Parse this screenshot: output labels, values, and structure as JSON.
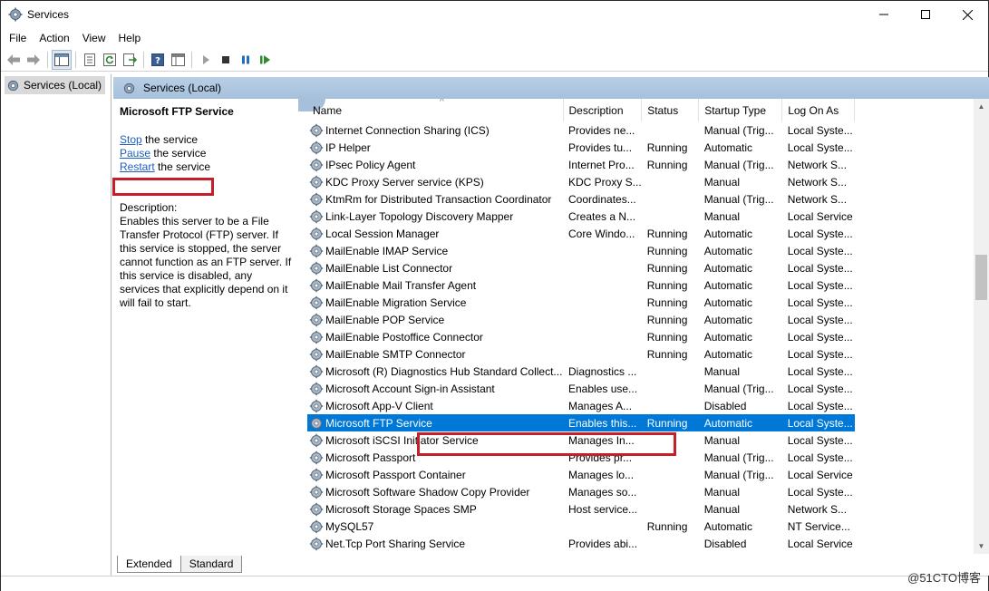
{
  "window": {
    "title": "Services"
  },
  "menu": [
    "File",
    "Action",
    "View",
    "Help"
  ],
  "tree": {
    "item": "Services (Local)"
  },
  "content_header": "Services (Local)",
  "detail": {
    "title": "Microsoft FTP Service",
    "actions": [
      {
        "link": "Stop",
        "rest": " the service"
      },
      {
        "link": "Pause",
        "rest": " the service"
      },
      {
        "link": "Restart",
        "rest": " the service"
      }
    ],
    "desc_label": "Description:",
    "desc_text": "Enables this server to be a File Transfer Protocol (FTP) server. If this service is stopped, the server cannot function as an FTP server. If this service is disabled, any services that explicitly depend on it will fail to start."
  },
  "columns": [
    "Name",
    "Description",
    "Status",
    "Startup Type",
    "Log On As"
  ],
  "rows": [
    [
      "Internet Connection Sharing (ICS)",
      "Provides ne...",
      "",
      "Manual (Trig...",
      "Local Syste..."
    ],
    [
      "IP Helper",
      "Provides tu...",
      "Running",
      "Automatic",
      "Local Syste..."
    ],
    [
      "IPsec Policy Agent",
      "Internet Pro...",
      "Running",
      "Manual (Trig...",
      "Network S..."
    ],
    [
      "KDC Proxy Server service (KPS)",
      "KDC Proxy S...",
      "",
      "Manual",
      "Network S..."
    ],
    [
      "KtmRm for Distributed Transaction Coordinator",
      "Coordinates...",
      "",
      "Manual (Trig...",
      "Network S..."
    ],
    [
      "Link-Layer Topology Discovery Mapper",
      "Creates a N...",
      "",
      "Manual",
      "Local Service"
    ],
    [
      "Local Session Manager",
      "Core Windo...",
      "Running",
      "Automatic",
      "Local Syste..."
    ],
    [
      "MailEnable IMAP Service",
      "",
      "Running",
      "Automatic",
      "Local Syste..."
    ],
    [
      "MailEnable List Connector",
      "",
      "Running",
      "Automatic",
      "Local Syste..."
    ],
    [
      "MailEnable Mail Transfer Agent",
      "",
      "Running",
      "Automatic",
      "Local Syste..."
    ],
    [
      "MailEnable Migration Service",
      "",
      "Running",
      "Automatic",
      "Local Syste..."
    ],
    [
      "MailEnable POP Service",
      "",
      "Running",
      "Automatic",
      "Local Syste..."
    ],
    [
      "MailEnable Postoffice Connector",
      "",
      "Running",
      "Automatic",
      "Local Syste..."
    ],
    [
      "MailEnable SMTP Connector",
      "",
      "Running",
      "Automatic",
      "Local Syste..."
    ],
    [
      "Microsoft (R) Diagnostics Hub Standard Collect...",
      "Diagnostics ...",
      "",
      "Manual",
      "Local Syste..."
    ],
    [
      "Microsoft Account Sign-in Assistant",
      "Enables use...",
      "",
      "Manual (Trig...",
      "Local Syste..."
    ],
    [
      "Microsoft App-V Client",
      "Manages A...",
      "",
      "Disabled",
      "Local Syste..."
    ],
    [
      "Microsoft FTP Service",
      "Enables this...",
      "Running",
      "Automatic",
      "Local Syste..."
    ],
    [
      "Microsoft iSCSI Initiator Service",
      "Manages In...",
      "",
      "Manual",
      "Local Syste..."
    ],
    [
      "Microsoft Passport",
      "Provides pr...",
      "",
      "Manual (Trig...",
      "Local Syste..."
    ],
    [
      "Microsoft Passport Container",
      "Manages lo...",
      "",
      "Manual (Trig...",
      "Local Service"
    ],
    [
      "Microsoft Software Shadow Copy Provider",
      "Manages so...",
      "",
      "Manual",
      "Local Syste..."
    ],
    [
      "Microsoft Storage Spaces SMP",
      "Host service...",
      "",
      "Manual",
      "Network S..."
    ],
    [
      "MySQL57",
      "",
      "Running",
      "Automatic",
      "NT Service..."
    ],
    [
      "Net.Tcp Port Sharing Service",
      "Provides abi...",
      "",
      "Disabled",
      "Local Service"
    ]
  ],
  "selected_index": 17,
  "tabs": [
    "Extended",
    "Standard"
  ],
  "watermark": "@51CTO博客",
  "colors": {
    "selection": "#0078d7",
    "highlight_box": "#c3202b",
    "header_band": "#a6c0dc"
  }
}
